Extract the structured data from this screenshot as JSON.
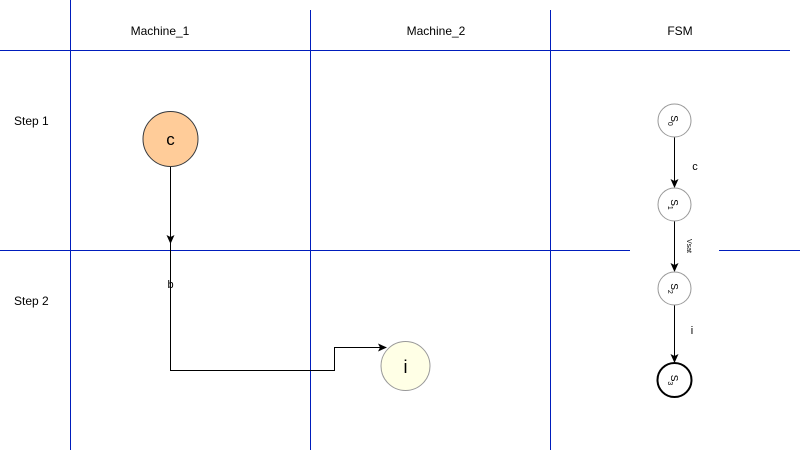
{
  "columns": [
    {
      "label": "Machine_1"
    },
    {
      "label": "Machine_2"
    },
    {
      "label": "FSM"
    }
  ],
  "rows": [
    {
      "label": "Step 1"
    },
    {
      "label": "Step 2"
    }
  ],
  "nodes": {
    "c": {
      "label": "c",
      "fill": "#FFCC99",
      "stroke": "#36393D"
    },
    "i": {
      "label": "i",
      "fill": "#FFFFE6",
      "stroke": "#999999"
    }
  },
  "edges": {
    "c_to_i": {
      "label": "b"
    }
  },
  "fsm": {
    "states": [
      {
        "label": "S",
        "sub": "0"
      },
      {
        "label": "S",
        "sub": "1"
      },
      {
        "label": "S",
        "sub": "2"
      },
      {
        "label": "S",
        "sub": "3"
      }
    ],
    "transitions": [
      {
        "label": "c"
      },
      {
        "label": "Vsat"
      },
      {
        "label": "i"
      }
    ]
  },
  "colors": {
    "grid_line": "#001DBC",
    "edge": "#000000",
    "fsm_state_stroke": "#999999",
    "fsm_final_stroke": "#000000"
  }
}
